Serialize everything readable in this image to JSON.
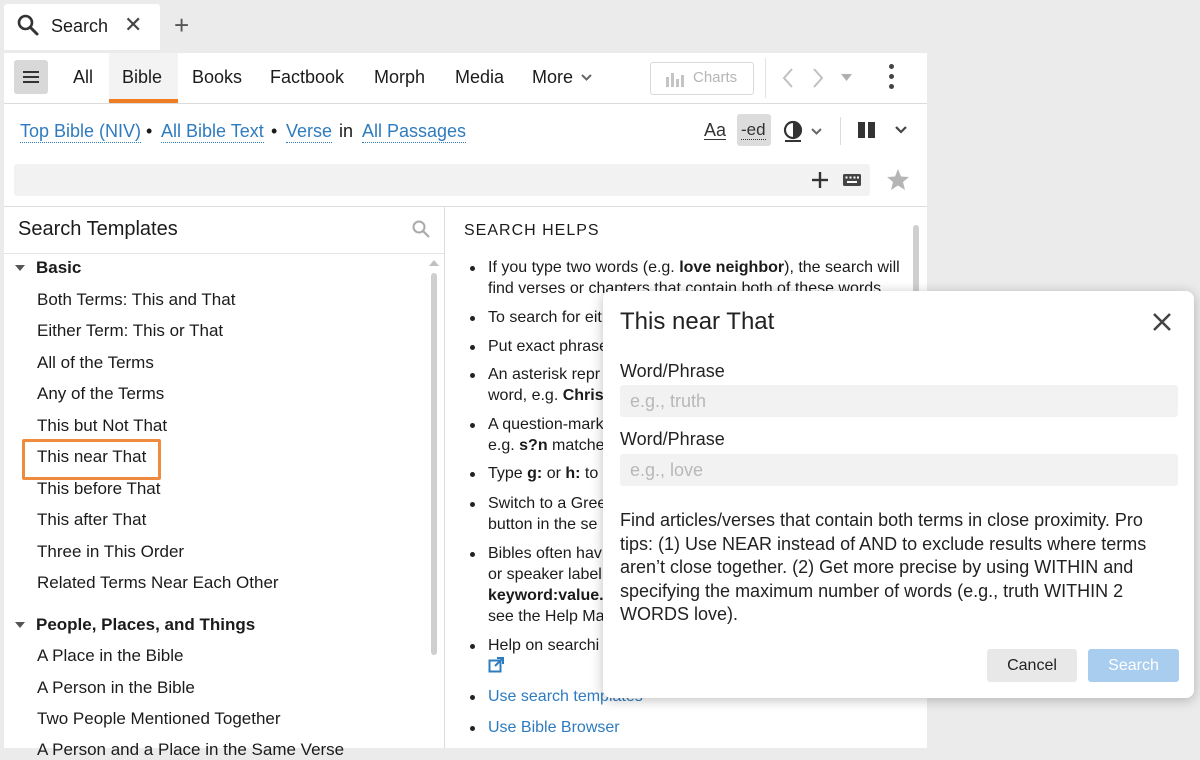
{
  "tab": {
    "label": "Search",
    "close": "✕",
    "add": "+"
  },
  "nav": {
    "tabs": [
      "All",
      "Bible",
      "Books",
      "Factbook",
      "Morph",
      "Media",
      "More"
    ],
    "active": "Bible",
    "charts_label": "Charts"
  },
  "scope": {
    "top_bible": "Top Bible (NIV)",
    "sep1": "•",
    "all_bible_text": "All Bible Text",
    "sep2": "•",
    "verse": "Verse",
    "in": "in",
    "all_passages": "All Passages"
  },
  "toolbar_right": {
    "font": "Aa",
    "ed": "-ed"
  },
  "templates": {
    "title": "Search Templates",
    "groups": [
      {
        "name": "Basic",
        "items": [
          "Both Terms: This and That",
          "Either Term: This or That",
          "All of the Terms",
          "Any of the Terms",
          "This but Not That",
          "This near That",
          "This before That",
          "This after That",
          "Three in This Order",
          "Related Terms Near Each Other"
        ]
      },
      {
        "name": "People, Places, and Things",
        "items": [
          "A Place in the Bible",
          "A Person in the Bible",
          "Two People Mentioned Together",
          "A Person and a Place in the Same Verse"
        ]
      }
    ],
    "selected": "This near That"
  },
  "helps": {
    "title": "SEARCH HELPS",
    "items": [
      {
        "lines": [
          [
            "If you type two words (e.g. ",
            "love neighbor",
            "), the search will"
          ],
          [
            "find verses or chapters that contain both of these words."
          ]
        ]
      },
      {
        "lines": [
          [
            "To search for either term"
          ]
        ]
      },
      {
        "lines": [
          [
            "Put exact phrase"
          ]
        ]
      },
      {
        "lines": [
          [
            "An asterisk repr"
          ],
          [
            "word, e.g. ",
            "Chris"
          ]
        ]
      },
      {
        "lines": [
          [
            "A question-mark"
          ],
          [
            "e.g. ",
            "s?n",
            " matche"
          ]
        ]
      },
      {
        "lines": [
          [
            "Type ",
            "g:",
            " or ",
            "h:",
            " to t"
          ]
        ]
      },
      {
        "lines": [
          [
            "Switch to a Gree"
          ],
          [
            "button in the se"
          ]
        ]
      },
      {
        "lines": [
          [
            "Bibles often hav"
          ],
          [
            "or speaker label"
          ],
          [
            "",
            "keyword:value."
          ],
          [
            "see the Help Ma"
          ]
        ]
      },
      {
        "lines": [
          [
            "Help on searchi"
          ]
        ]
      }
    ],
    "links": [
      "Use search templates",
      "Use Bible Browser"
    ]
  },
  "dialog": {
    "title": "This near That",
    "field1_label": "Word/Phrase",
    "field1_placeholder": "e.g., truth",
    "field2_label": "Word/Phrase",
    "field2_placeholder": "e.g., love",
    "description": "Find articles/verses that contain both terms in close proximity. Pro tips: (1) Use NEAR instead of AND to exclude results where terms aren’t close together. (2) Get more precise by using WITHIN and specifying the maximum number of words (e.g., truth WITHIN 2 WORDS love).",
    "cancel": "Cancel",
    "search": "Search"
  },
  "colors": {
    "accent": "#ee7d23",
    "link": "#2f7bbf",
    "highlight": "#f08a3e",
    "search_btn": "#a9cdef"
  },
  "icons": [
    "search-icon",
    "close-icon",
    "plus-icon",
    "menu-icon",
    "chevron-down-icon",
    "chart-icon",
    "back-icon",
    "forward-icon",
    "kebab-icon",
    "font-icon",
    "ed-icon",
    "globe-icon",
    "columns-icon",
    "keyboard-icon",
    "star-icon",
    "external-link-icon"
  ]
}
